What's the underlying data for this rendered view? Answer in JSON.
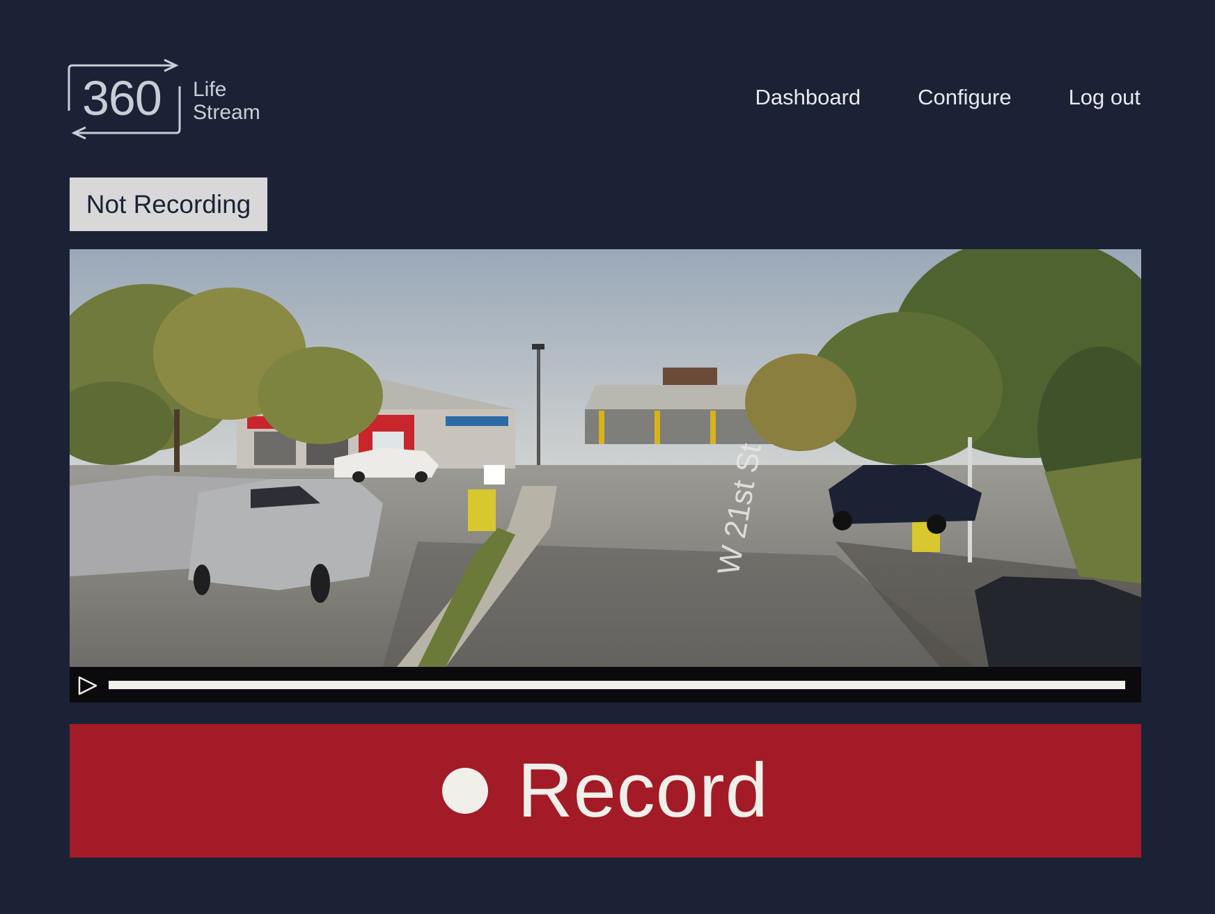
{
  "logo": {
    "number": "360",
    "word1": "Life",
    "word2": "Stream"
  },
  "nav": {
    "items": [
      "Dashboard",
      "Configure",
      "Log out"
    ]
  },
  "status": {
    "label": "Not Recording"
  },
  "video": {
    "street_sign": "W 21st St",
    "progress": 1.0
  },
  "record": {
    "label": "Record"
  },
  "colors": {
    "background": "#1b2236",
    "record": "#a21b26",
    "badge": "#d8d8d9"
  }
}
